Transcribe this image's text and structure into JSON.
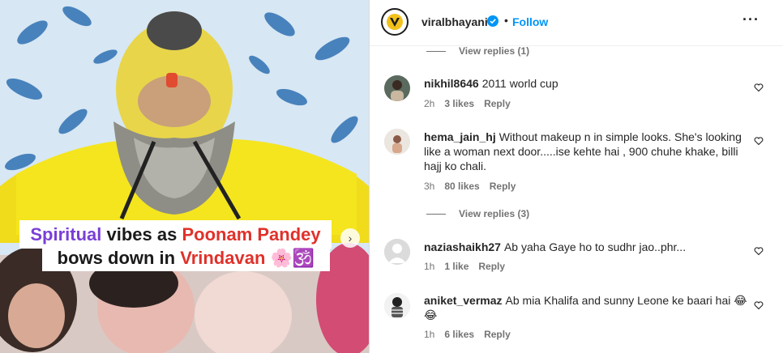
{
  "post": {
    "caption_line1_word1": "Spiritual",
    "caption_line1_word2": "vibes as",
    "caption_line1_word3": "Poonam Pandey",
    "caption_line2_word1": "bows down in",
    "caption_line2_word2": "Vrindavan",
    "caption_emojis": "🌸🕉️"
  },
  "header": {
    "username": "viralbhayani",
    "separator": "•",
    "follow_label": "Follow",
    "more_label": "···"
  },
  "comments": {
    "top_view_replies": "View replies (1)",
    "items": [
      {
        "username": "nikhil8646",
        "text": "2011 world cup",
        "time": "2h",
        "likes": "3 likes",
        "reply": "Reply"
      },
      {
        "username": "hema_jain_hj",
        "text": "Without makeup n in simple looks. She's looking like a woman next door.....ise kehte hai , 900 chuhe khake, billi hajj ko chali.",
        "time": "3h",
        "likes": "80 likes",
        "reply": "Reply",
        "view_replies": "View replies (3)"
      },
      {
        "username": "naziashaikh27",
        "text": "Ab yaha Gaye ho to sudhr jao..phr...",
        "time": "1h",
        "likes": "1 like",
        "reply": "Reply"
      },
      {
        "username": "aniket_vermaz",
        "text": "Ab mia Khalifa and sunny Leone ke baari hai 😂😂",
        "time": "1h",
        "likes": "6 likes",
        "reply": "Reply"
      }
    ]
  }
}
